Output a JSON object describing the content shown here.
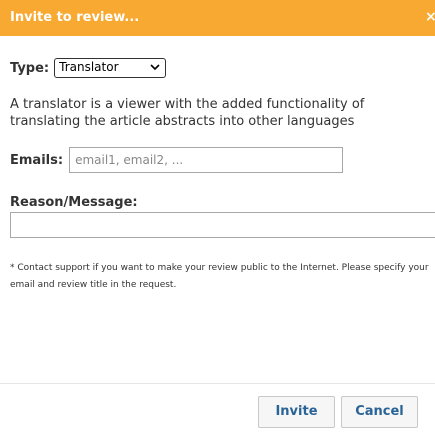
{
  "dialog": {
    "title": "Invite to review...",
    "close_symbol": "×",
    "header_color": "#f7a932"
  },
  "type_field": {
    "label": "Type:",
    "selected_value": "Translator"
  },
  "description": "A translator is a viewer with the added functionality of translating the article abstracts into other languages",
  "emails_field": {
    "label": "Emails:",
    "value": "",
    "placeholder": "email1, email2, ..."
  },
  "reason_field": {
    "label": "Reason/Message:",
    "value": ""
  },
  "note": "* Contact support if you want to make your review public to the Internet. Please specify your email and review title in the request.",
  "buttons": {
    "invite_label": "Invite",
    "cancel_label": "Cancel",
    "link_color": "#2a6496"
  },
  "icons": {
    "close": "close-icon",
    "dropdown": "chevron-down-icon"
  }
}
